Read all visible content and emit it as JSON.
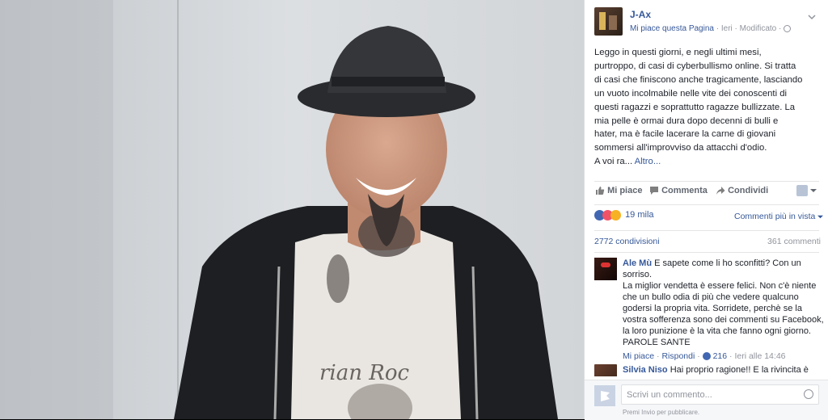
{
  "post": {
    "author": "J-Ax",
    "like_page": "Mi piace questa Pagina",
    "time": "Ieri",
    "edited": "Modificato",
    "body_lines": [
      "Leggo in questi giorni, e negli ultimi mesi,",
      "purtroppo, di casi di cyberbullismo online. Si tratta",
      "di casi che finiscono anche tragicamente, lasciando",
      "un vuoto incolmabile nelle vite dei conoscenti di",
      "questi ragazzi e soprattutto ragazze bullizzate. La",
      "mia pelle è ormai dura dopo decenni di bulli e",
      "hater, ma è facile lacerare la carne di giovani",
      "sommersi all'improvviso da attacchi d'odio."
    ],
    "last_line": "A voi ra...",
    "more": "Altro..."
  },
  "actions": {
    "like": "Mi piace",
    "comment": "Commenta",
    "share": "Condividi"
  },
  "reactions": {
    "count": "19 mila",
    "sort": "Commenti più in vista"
  },
  "stats": {
    "shares": "2772 condivisioni",
    "comments": "361 commenti"
  },
  "comments": [
    {
      "name": "Ale Mù",
      "lines": [
        "E sapete come li ho sconfitti? Con un",
        "sorriso.",
        "La miglior vendetta è essere felici. Non c'è niente",
        "che un bullo odia di più che vedere qualcuno",
        "godersi la propria vita. Sorridete, perchè se la",
        "vostra sofferenza sono dei commenti su Facebook,",
        "la loro punizione è la vita che fanno ogni giorno.",
        "PAROLE SANTE"
      ],
      "like": "Mi piace",
      "reply": "Rispondi",
      "likes": "216",
      "time": "Ieri alle 14:46"
    },
    {
      "name": "Silvia Niso",
      "first_line": "Hai proprio ragione!! E la rivincita è"
    }
  ],
  "composer": {
    "placeholder": "Scrivi un commento...",
    "hint": "Premi Invio per pubblicare."
  },
  "colors": {
    "link": "#365899",
    "muted": "#90949c",
    "like_blue": "#4267b2"
  }
}
